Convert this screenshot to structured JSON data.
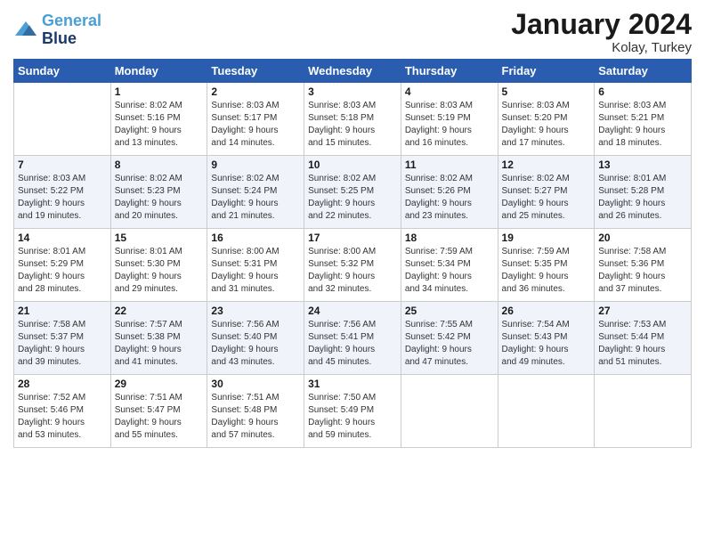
{
  "logo": {
    "line1": "General",
    "line2": "Blue"
  },
  "title": "January 2024",
  "subtitle": "Kolay, Turkey",
  "columns": [
    "Sunday",
    "Monday",
    "Tuesday",
    "Wednesday",
    "Thursday",
    "Friday",
    "Saturday"
  ],
  "weeks": [
    [
      {
        "day": "",
        "info": ""
      },
      {
        "day": "1",
        "info": "Sunrise: 8:02 AM\nSunset: 5:16 PM\nDaylight: 9 hours\nand 13 minutes."
      },
      {
        "day": "2",
        "info": "Sunrise: 8:03 AM\nSunset: 5:17 PM\nDaylight: 9 hours\nand 14 minutes."
      },
      {
        "day": "3",
        "info": "Sunrise: 8:03 AM\nSunset: 5:18 PM\nDaylight: 9 hours\nand 15 minutes."
      },
      {
        "day": "4",
        "info": "Sunrise: 8:03 AM\nSunset: 5:19 PM\nDaylight: 9 hours\nand 16 minutes."
      },
      {
        "day": "5",
        "info": "Sunrise: 8:03 AM\nSunset: 5:20 PM\nDaylight: 9 hours\nand 17 minutes."
      },
      {
        "day": "6",
        "info": "Sunrise: 8:03 AM\nSunset: 5:21 PM\nDaylight: 9 hours\nand 18 minutes."
      }
    ],
    [
      {
        "day": "7",
        "info": "Sunrise: 8:03 AM\nSunset: 5:22 PM\nDaylight: 9 hours\nand 19 minutes."
      },
      {
        "day": "8",
        "info": "Sunrise: 8:02 AM\nSunset: 5:23 PM\nDaylight: 9 hours\nand 20 minutes."
      },
      {
        "day": "9",
        "info": "Sunrise: 8:02 AM\nSunset: 5:24 PM\nDaylight: 9 hours\nand 21 minutes."
      },
      {
        "day": "10",
        "info": "Sunrise: 8:02 AM\nSunset: 5:25 PM\nDaylight: 9 hours\nand 22 minutes."
      },
      {
        "day": "11",
        "info": "Sunrise: 8:02 AM\nSunset: 5:26 PM\nDaylight: 9 hours\nand 23 minutes."
      },
      {
        "day": "12",
        "info": "Sunrise: 8:02 AM\nSunset: 5:27 PM\nDaylight: 9 hours\nand 25 minutes."
      },
      {
        "day": "13",
        "info": "Sunrise: 8:01 AM\nSunset: 5:28 PM\nDaylight: 9 hours\nand 26 minutes."
      }
    ],
    [
      {
        "day": "14",
        "info": "Sunrise: 8:01 AM\nSunset: 5:29 PM\nDaylight: 9 hours\nand 28 minutes."
      },
      {
        "day": "15",
        "info": "Sunrise: 8:01 AM\nSunset: 5:30 PM\nDaylight: 9 hours\nand 29 minutes."
      },
      {
        "day": "16",
        "info": "Sunrise: 8:00 AM\nSunset: 5:31 PM\nDaylight: 9 hours\nand 31 minutes."
      },
      {
        "day": "17",
        "info": "Sunrise: 8:00 AM\nSunset: 5:32 PM\nDaylight: 9 hours\nand 32 minutes."
      },
      {
        "day": "18",
        "info": "Sunrise: 7:59 AM\nSunset: 5:34 PM\nDaylight: 9 hours\nand 34 minutes."
      },
      {
        "day": "19",
        "info": "Sunrise: 7:59 AM\nSunset: 5:35 PM\nDaylight: 9 hours\nand 36 minutes."
      },
      {
        "day": "20",
        "info": "Sunrise: 7:58 AM\nSunset: 5:36 PM\nDaylight: 9 hours\nand 37 minutes."
      }
    ],
    [
      {
        "day": "21",
        "info": "Sunrise: 7:58 AM\nSunset: 5:37 PM\nDaylight: 9 hours\nand 39 minutes."
      },
      {
        "day": "22",
        "info": "Sunrise: 7:57 AM\nSunset: 5:38 PM\nDaylight: 9 hours\nand 41 minutes."
      },
      {
        "day": "23",
        "info": "Sunrise: 7:56 AM\nSunset: 5:40 PM\nDaylight: 9 hours\nand 43 minutes."
      },
      {
        "day": "24",
        "info": "Sunrise: 7:56 AM\nSunset: 5:41 PM\nDaylight: 9 hours\nand 45 minutes."
      },
      {
        "day": "25",
        "info": "Sunrise: 7:55 AM\nSunset: 5:42 PM\nDaylight: 9 hours\nand 47 minutes."
      },
      {
        "day": "26",
        "info": "Sunrise: 7:54 AM\nSunset: 5:43 PM\nDaylight: 9 hours\nand 49 minutes."
      },
      {
        "day": "27",
        "info": "Sunrise: 7:53 AM\nSunset: 5:44 PM\nDaylight: 9 hours\nand 51 minutes."
      }
    ],
    [
      {
        "day": "28",
        "info": "Sunrise: 7:52 AM\nSunset: 5:46 PM\nDaylight: 9 hours\nand 53 minutes."
      },
      {
        "day": "29",
        "info": "Sunrise: 7:51 AM\nSunset: 5:47 PM\nDaylight: 9 hours\nand 55 minutes."
      },
      {
        "day": "30",
        "info": "Sunrise: 7:51 AM\nSunset: 5:48 PM\nDaylight: 9 hours\nand 57 minutes."
      },
      {
        "day": "31",
        "info": "Sunrise: 7:50 AM\nSunset: 5:49 PM\nDaylight: 9 hours\nand 59 minutes."
      },
      {
        "day": "",
        "info": ""
      },
      {
        "day": "",
        "info": ""
      },
      {
        "day": "",
        "info": ""
      }
    ]
  ]
}
